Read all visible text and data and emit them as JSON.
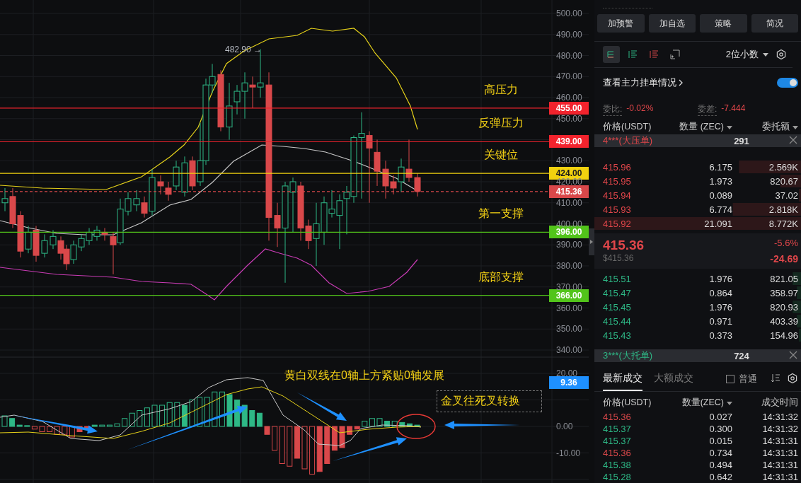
{
  "chart": {
    "y_ticks": [
      "500.00",
      "490.00",
      "480.00",
      "470.00",
      "460.00",
      "450.00",
      "430.00",
      "420.00",
      "410.00",
      "400.00",
      "390.00",
      "380.00",
      "370.00",
      "360.00",
      "350.00",
      "340.00"
    ],
    "price_levels": [
      {
        "label": "455.00",
        "color": "#f2232d",
        "kind": "solid",
        "annotation": "高压力"
      },
      {
        "label": "439.00",
        "color": "#f2232d",
        "kind": "solid",
        "annotation": "反弹压力"
      },
      {
        "label": "424.00",
        "color": "#f2d20f",
        "kind": "solid",
        "annotation": "关键位"
      },
      {
        "label": "415.36",
        "color": "#d9484a",
        "kind": "dashed"
      },
      {
        "label": "396.00",
        "color": "#52c41a",
        "kind": "solid",
        "annotation": "第一支撑"
      },
      {
        "label": "366.00",
        "color": "#52c41a",
        "kind": "solid",
        "annotation": "底部支撑"
      }
    ],
    "high_marker": "482.90 →",
    "macd": {
      "y_ticks": [
        "20.00",
        "0.00",
        "-10.00"
      ],
      "value_tag": "9.36",
      "notes": [
        {
          "text": "黄白双线在0轴上方紧贴0轴发展",
          "boxed": false
        },
        {
          "text": "金叉往死叉转换",
          "boxed": true
        }
      ]
    }
  },
  "header_buttons": [
    "加预警",
    "加自选",
    "策略",
    "简况"
  ],
  "order_book": {
    "view_modes": [
      {
        "kind": "both",
        "selected": true
      },
      {
        "kind": "bids",
        "selected": false
      },
      {
        "kind": "asks",
        "selected": false
      },
      {
        "kind": "custom",
        "selected": false
      }
    ],
    "decimals": "2位小数",
    "main_orders_link": "查看主力挂单情况",
    "main_orders_toggle": {
      "on": true
    },
    "stats": [
      {
        "label": "委比:",
        "value": "-0.02%"
      },
      {
        "label": "委差:",
        "value": "-7.444"
      }
    ],
    "columns": [
      "价格(USDT)",
      "数量 (ZEC)",
      "委托额"
    ],
    "ask_banner": {
      "label": "4***(大压单)",
      "count": "291"
    },
    "asks": [
      {
        "price": "415.96",
        "qty": "6.175",
        "total": "2.569K",
        "level": 0.3
      },
      {
        "price": "415.95",
        "qty": "1.973",
        "total": "820.67",
        "level": 0.1
      },
      {
        "price": "415.94",
        "qty": "0.089",
        "total": "37.02",
        "level": 0.01
      },
      {
        "price": "415.93",
        "qty": "6.774",
        "total": "2.818K",
        "level": 0.33
      },
      {
        "price": "415.92",
        "qty": "21.091",
        "total": "8.772K",
        "level": 1
      }
    ],
    "last": {
      "price": "415.36",
      "usd": "$415.36",
      "pct": "-5.6%",
      "change": "-24.69"
    },
    "bids": [
      {
        "price": "415.51",
        "qty": "1.976",
        "total": "821.05",
        "level": 0.04
      },
      {
        "price": "415.47",
        "qty": "0.864",
        "total": "358.97",
        "level": 0.02
      },
      {
        "price": "415.45",
        "qty": "1.976",
        "total": "820.93",
        "level": 0.04
      },
      {
        "price": "415.44",
        "qty": "0.971",
        "total": "403.39",
        "level": 0.02
      },
      {
        "price": "415.43",
        "qty": "0.373",
        "total": "154.96",
        "level": 0.01
      }
    ],
    "bid_banner": {
      "label": "3***(大托单)",
      "count": "724"
    }
  },
  "trades": {
    "tabs": [
      {
        "label": "最新成交",
        "selected": true
      },
      {
        "label": "大额成交",
        "selected": false
      }
    ],
    "filter": {
      "label": "普通",
      "checked": false
    },
    "columns": [
      "价格(USDT)",
      "数量(ZEC)",
      "成交时间"
    ],
    "rows": [
      {
        "price": "415.36",
        "qty": "0.027",
        "time": "14:31:32",
        "color": "#d9484a"
      },
      {
        "price": "415.37",
        "qty": "0.300",
        "time": "14:31:32",
        "color": "#2eb886"
      },
      {
        "price": "415.37",
        "qty": "0.015",
        "time": "14:31:31",
        "color": "#2eb886"
      },
      {
        "price": "415.36",
        "qty": "0.734",
        "time": "14:31:31",
        "color": "#d9484a"
      },
      {
        "price": "415.38",
        "qty": "0.494",
        "time": "14:31:31",
        "color": "#2eb886"
      },
      {
        "price": "415.28",
        "qty": "0.642",
        "time": "14:31:31",
        "color": "#2eb886"
      }
    ]
  }
}
